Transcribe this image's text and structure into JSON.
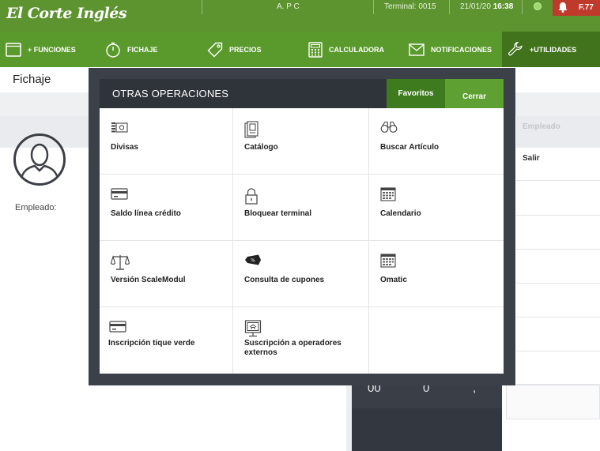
{
  "header": {
    "logo": "El Corte Inglés",
    "user": "A. P C",
    "terminal": "Terminal: 0015",
    "date": "21/01/20",
    "time": "16:38",
    "alert_code": "F.77"
  },
  "menu": [
    {
      "label": "+ FUNCIONES",
      "icon": "window-icon"
    },
    {
      "label": "FICHAJE",
      "icon": "timer-icon"
    },
    {
      "label": "PRECIOS",
      "icon": "price-tag-icon"
    },
    {
      "label": "CALCULADORA",
      "icon": "calculator-icon"
    },
    {
      "label": "NOTIFICACIONES",
      "icon": "envelope-icon"
    },
    {
      "label": "+UTILIDADES",
      "icon": "wrench-icon",
      "active": true
    }
  ],
  "page": {
    "title": "Fichaje",
    "employee_label": "Empleado:",
    "right_header": "Empleado",
    "right_rows": [
      "Salir",
      "",
      "",
      "",
      "",
      "",
      ""
    ],
    "counter": [
      "00",
      "0",
      ","
    ]
  },
  "modal": {
    "title": "OTRAS OPERACIONES",
    "favorites": "Favoritos",
    "close": "Cerrar",
    "items": [
      {
        "label": "Divisas",
        "icon": "currency-icon"
      },
      {
        "label": "Catálogo",
        "icon": "catalog-icon"
      },
      {
        "label": "Buscar Artículo",
        "icon": "binoculars-icon"
      },
      {
        "label": "Saldo línea crédito",
        "icon": "credit-card-icon"
      },
      {
        "label": "Bloquear terminal",
        "icon": "padlock-icon"
      },
      {
        "label": "Calendario",
        "icon": "calendar-icon"
      },
      {
        "label": "Versión ScaleModul",
        "icon": "scale-icon"
      },
      {
        "label": "Consulta de cupones",
        "icon": "coupon-icon"
      },
      {
        "label": "Omatic",
        "icon": "calendar-icon"
      },
      {
        "label": "Inscripción tique verde",
        "icon": "credit-card-icon"
      },
      {
        "label": "Suscripción a operadores externos",
        "icon": "monitor-icon"
      },
      {
        "label": "",
        "icon": ""
      }
    ]
  },
  "colors": {
    "topbar": "#5e9430",
    "menubar": "#5a9a2c",
    "menu_active": "#40731c",
    "modal_bg": "#3c4048",
    "favorites": "#3e7a1e",
    "close": "#5fa032",
    "alert": "#c03a2b"
  }
}
